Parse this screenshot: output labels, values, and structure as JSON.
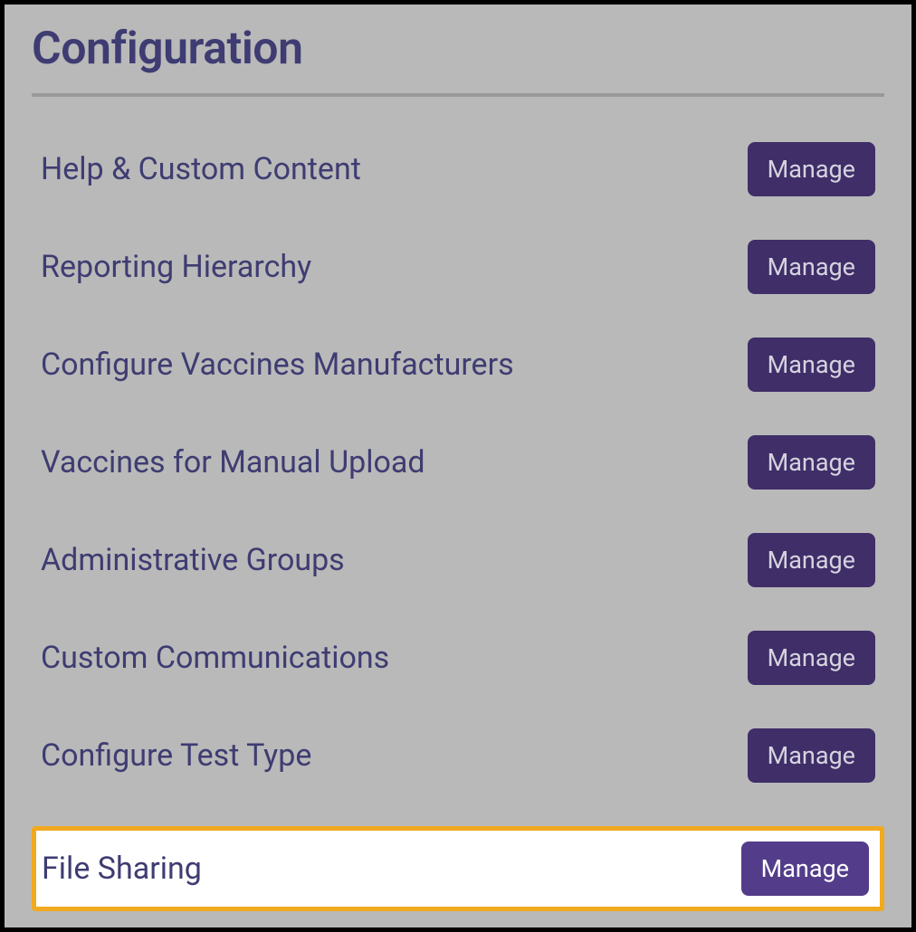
{
  "header": {
    "title": "Configuration"
  },
  "config": {
    "button_label": "Manage",
    "items": [
      {
        "label": "Help & Custom Content",
        "highlighted": false
      },
      {
        "label": "Reporting Hierarchy",
        "highlighted": false
      },
      {
        "label": "Configure Vaccines Manufacturers",
        "highlighted": false
      },
      {
        "label": "Vaccines for Manual Upload",
        "highlighted": false
      },
      {
        "label": "Administrative Groups",
        "highlighted": false
      },
      {
        "label": "Custom Communications",
        "highlighted": false
      },
      {
        "label": "Configure Test Type",
        "highlighted": false
      },
      {
        "label": "File Sharing",
        "highlighted": true
      }
    ]
  }
}
